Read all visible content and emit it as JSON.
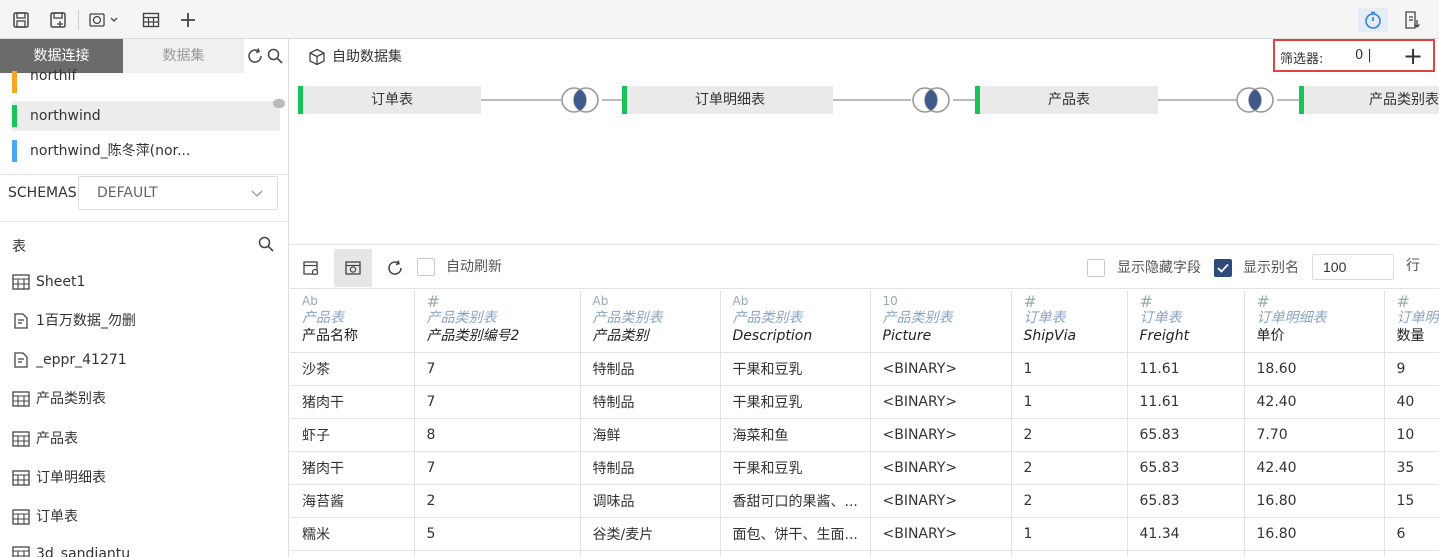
{
  "toolbar": {
    "icons": [
      "save-icon",
      "save-as-icon",
      "preview-icon",
      "table-icon",
      "add-icon",
      "timer-icon",
      "export-icon"
    ]
  },
  "sidebar": {
    "tabs": {
      "connections": "数据连接",
      "datasets": "数据集"
    },
    "connections": [
      {
        "label": "northif",
        "color": "#f5a623"
      },
      {
        "label": "northwind",
        "color": "#18c45a"
      },
      {
        "label": "northwind_陈冬萍(nor...",
        "color": "#4aa8f0"
      }
    ],
    "schemas_label": "SCHEMAS",
    "schemas_value": "DEFAULT",
    "tables_label": "表",
    "tables": [
      {
        "label": "Sheet1",
        "icon": "table-icon"
      },
      {
        "label": "1百万数据_勿删",
        "icon": "sql-icon"
      },
      {
        "label": "_eppr_41271",
        "icon": "sql-icon"
      },
      {
        "label": "产品类别表",
        "icon": "table-icon"
      },
      {
        "label": "产品表",
        "icon": "table-icon"
      },
      {
        "label": "订单明细表",
        "icon": "table-icon"
      },
      {
        "label": "订单表",
        "icon": "table-icon"
      },
      {
        "label": "3d_sandiantu",
        "icon": "table-icon"
      }
    ]
  },
  "main": {
    "self_dataset": "自助数据集",
    "filter_label": "筛选器:",
    "filter_count": "0 |",
    "filter_add": "+",
    "nodes": [
      "订单表",
      "订单明细表",
      "产品表",
      "产品类别表"
    ],
    "auto_refresh": "自动刷新",
    "show_hidden": "显示隐藏字段",
    "show_alias": "显示别名",
    "row_count": "100",
    "row_unit": "行"
  },
  "grid": {
    "columns": [
      {
        "type": "Ab",
        "table": "产品表",
        "field": "产品名称"
      },
      {
        "type": "#",
        "table": "产品类别表",
        "field": "产品类别编号2"
      },
      {
        "type": "Ab",
        "table": "产品类别表",
        "field": "产品类别"
      },
      {
        "type": "Ab",
        "table": "产品类别表",
        "field": "Description"
      },
      {
        "type": "10",
        "table": "产品类别表",
        "field": "Picture"
      },
      {
        "type": "#",
        "table": "订单表",
        "field": "ShipVia"
      },
      {
        "type": "#",
        "table": "订单表",
        "field": "Freight"
      },
      {
        "type": "#",
        "table": "订单明细表",
        "field": "单价"
      },
      {
        "type": "#",
        "table": "订单明细表",
        "field": "数量"
      }
    ],
    "rows": [
      [
        "沙茶",
        "7",
        "特制品",
        "干果和豆乳",
        "<BINARY>",
        "1",
        "11.61",
        "18.60",
        "9"
      ],
      [
        "猪肉干",
        "7",
        "特制品",
        "干果和豆乳",
        "<BINARY>",
        "1",
        "11.61",
        "42.40",
        "40"
      ],
      [
        "虾子",
        "8",
        "海鲜",
        "海菜和鱼",
        "<BINARY>",
        "2",
        "65.83",
        "7.70",
        "10"
      ],
      [
        "猪肉干",
        "7",
        "特制品",
        "干果和豆乳",
        "<BINARY>",
        "2",
        "65.83",
        "42.40",
        "35"
      ],
      [
        "海苔酱",
        "2",
        "调味品",
        "香甜可口的果酱、...",
        "<BINARY>",
        "2",
        "65.83",
        "16.80",
        "15"
      ],
      [
        "糯米",
        "5",
        "谷类/麦片",
        "面包、饼干、生面...",
        "<BINARY>",
        "1",
        "41.34",
        "16.80",
        "6"
      ],
      [
        "",
        "",
        "",
        "",
        "",
        "",
        "",
        "",
        ""
      ]
    ]
  }
}
